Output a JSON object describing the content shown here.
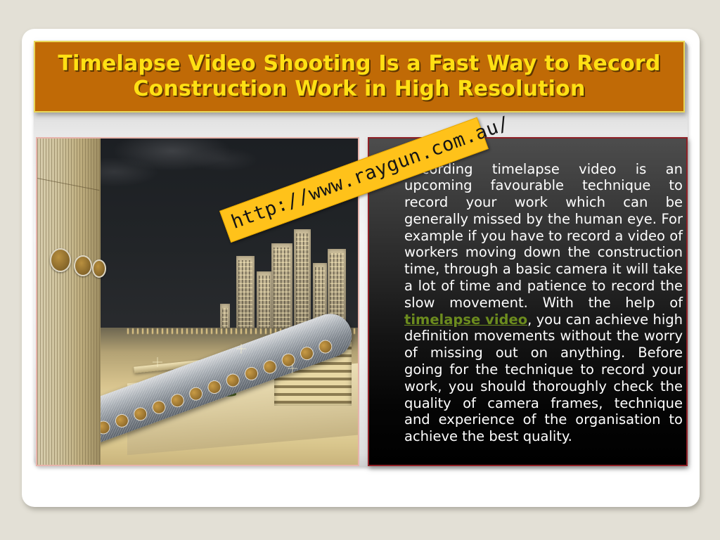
{
  "slide": {
    "title": "Timelapse Video Shooting Is a Fast Way to Record Construction Work in High Resolution",
    "title_color": "#ffe014",
    "title_bar_color": "#c06a06",
    "title_bar_border_color": "#e8d75a"
  },
  "image": {
    "alt": "Night cityscape with illuminated high-rise towers, elevated roadways and a tubular pedestrian sky-bridge with round windows",
    "border_color": "#e7b4ac"
  },
  "body": {
    "bullet_color": "#e8761f",
    "border_color": "#8f2026",
    "text_before_link": "Recording timelapse video is an upcoming favourable technique to record your work which can be generally missed by the human eye. For example if you have to record a video of workers moving down the construction time, through a basic camera it will take a lot of time and patience to record the slow movement. With the help of ",
    "link_text": "timelapse video",
    "link_color": "#6c8c1e",
    "text_after_link": ", you can achieve high definition movements without the worry of missing out on anything. Before going for the technique to record your work, you should thoroughly check the quality of camera frames, technique and experience of the organisation to achieve the best quality."
  },
  "watermark": {
    "url": "http://www.raygun.com.au/",
    "background_color": "#ffc21a",
    "text_color": "#151515"
  }
}
